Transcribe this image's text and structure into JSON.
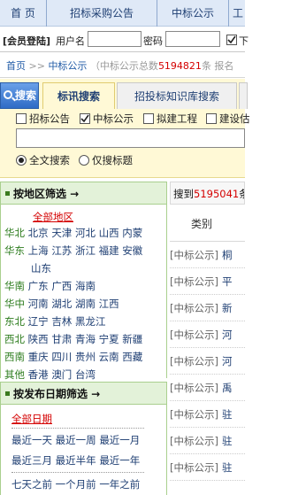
{
  "topnav": {
    "items": [
      "首 页",
      "招标采购公告",
      "中标公示",
      "工"
    ]
  },
  "login": {
    "section_label": "[会员登陆]",
    "username_label": "用户名",
    "password_label": "密码",
    "remember_label": "下",
    "username_value": "",
    "password_value": ""
  },
  "breadcrumb": {
    "home": "首页",
    "sep": ">>",
    "current": "中标公示",
    "count_prefix": "（中标公示总数",
    "count": "5194821",
    "count_suffix": "条 报名"
  },
  "search": {
    "button": "搜索",
    "tabs": [
      "标讯搜索",
      "招投标知识库搜索",
      ""
    ],
    "categories": [
      {
        "label": "招标公告",
        "checked": false
      },
      {
        "label": "中标公示",
        "checked": true
      },
      {
        "label": "拟建工程",
        "checked": false
      },
      {
        "label": "建设估",
        "checked": false
      }
    ],
    "keyword_value": "",
    "modes": [
      {
        "label": "全文搜索",
        "selected": true
      },
      {
        "label": "仅搜标题",
        "selected": false
      }
    ]
  },
  "region_filter": {
    "title": "按地区筛选 →",
    "all": "全部地区",
    "rows": [
      {
        "region": "华北",
        "cities": [
          "北京",
          "天津",
          "河北",
          "山西",
          "内蒙"
        ]
      },
      {
        "region": "华东",
        "cities": [
          "上海",
          "江苏",
          "浙江",
          "福建",
          "安徽"
        ]
      },
      {
        "region": "",
        "cities": [
          "山东"
        ]
      },
      {
        "region": "华南",
        "cities": [
          "广东",
          "广西",
          "海南"
        ]
      },
      {
        "region": "华中",
        "cities": [
          "河南",
          "湖北",
          "湖南",
          "江西"
        ]
      },
      {
        "region": "东北",
        "cities": [
          "辽宁",
          "吉林",
          "黑龙江"
        ]
      },
      {
        "region": "西北",
        "cities": [
          "陕西",
          "甘肃",
          "青海",
          "宁夏",
          "新疆"
        ]
      },
      {
        "region": "西南",
        "cities": [
          "重庆",
          "四川",
          "贵州",
          "云南",
          "西藏"
        ]
      },
      {
        "region": "其他",
        "cities": [
          "香港",
          "澳门",
          "台湾"
        ]
      }
    ]
  },
  "date_filter": {
    "title": "按发布日期筛选 →",
    "all": "全部日期",
    "rows": [
      [
        "最近一天",
        "最近一周",
        "最近一月"
      ],
      [
        "最近三月",
        "最近半年",
        "最近一年"
      ],
      [
        "七天之前",
        "一个月前",
        "一年之前"
      ]
    ]
  },
  "results": {
    "count_prefix": "搜到",
    "count": "5195041",
    "count_suffix": "条",
    "column_category": "类别",
    "rows": [
      {
        "category": "[中标公示]",
        "title": "桐"
      },
      {
        "category": "[中标公示]",
        "title": "平"
      },
      {
        "category": "[中标公示]",
        "title": "新"
      },
      {
        "category": "[中标公示]",
        "title": "河"
      },
      {
        "category": "[中标公示]",
        "title": "河"
      },
      {
        "category": "[中标公示]",
        "title": "禹"
      },
      {
        "category": "[中标公示]",
        "title": "驻"
      },
      {
        "category": "[中标公示]",
        "title": "驻"
      },
      {
        "category": "[中标公示]",
        "title": "驻"
      }
    ]
  }
}
